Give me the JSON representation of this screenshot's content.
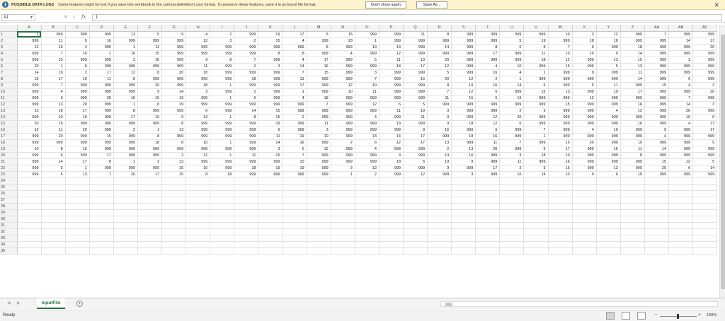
{
  "message_bar": {
    "title": "POSSIBLE DATA LOSS",
    "text": "Some features might be lost if you save this workbook in the comma-delimited (.csv) format. To preserve these features, save it in an Excel file format.",
    "dont_show_label": "Don't show again",
    "save_as_label": "Save As..."
  },
  "formula_bar": {
    "name_box": "A1",
    "formula": "1"
  },
  "columns": [
    "A",
    "B",
    "C",
    "D",
    "E",
    "F",
    "G",
    "H",
    "I",
    "J",
    "K",
    "L",
    "M",
    "N",
    "O",
    "P",
    "Q",
    "R",
    "S",
    "T",
    "U",
    "V",
    "W",
    "X",
    "Y",
    "Z",
    "AA",
    "AB",
    "AC"
  ],
  "rows": [
    [
      "1",
      "999",
      "999",
      "999",
      "13",
      "5",
      "9",
      "4",
      "2",
      "999",
      "19",
      "17",
      "6",
      "15",
      "999",
      "999",
      "11",
      "8",
      "999",
      "999",
      "999",
      "999",
      "10",
      "3",
      "12",
      "999",
      "7",
      "999",
      "999"
    ],
    [
      "999",
      "11",
      "9",
      "16",
      "999",
      "999",
      "999",
      "12",
      "3",
      "2",
      "15",
      "4",
      "999",
      "20",
      "1",
      "999",
      "999",
      "999",
      "999",
      "999",
      "5",
      "19",
      "999",
      "18",
      "10",
      "999",
      "999",
      "14",
      "17"
    ],
    [
      "12",
      "15",
      "4",
      "999",
      "1",
      "11",
      "999",
      "999",
      "999",
      "999",
      "999",
      "999",
      "8",
      "999",
      "19",
      "13",
      "999",
      "14",
      "999",
      "8",
      "6",
      "9",
      "7",
      "5",
      "999",
      "18",
      "999",
      "999",
      "20"
    ],
    [
      "999",
      "7",
      "20",
      "1",
      "16",
      "15",
      "999",
      "999",
      "999",
      "999",
      "8",
      "8",
      "999",
      "4",
      "999",
      "12",
      "999",
      "999",
      "999",
      "17",
      "999",
      "11",
      "13",
      "19",
      "9",
      "14",
      "999",
      "999",
      "999"
    ],
    [
      "999",
      "10",
      "999",
      "999",
      "2",
      "16",
      "999",
      "9",
      "8",
      "7",
      "999",
      "4",
      "17",
      "999",
      "5",
      "11",
      "19",
      "20",
      "999",
      "999",
      "999",
      "18",
      "12",
      "999",
      "13",
      "15",
      "999",
      "3",
      "999"
    ],
    [
      "20",
      "1",
      "6",
      "999",
      "999",
      "999",
      "999",
      "11",
      "999",
      "2",
      "3",
      "14",
      "16",
      "999",
      "999",
      "18",
      "17",
      "12",
      "999",
      "4",
      "10",
      "999",
      "15",
      "999",
      "5",
      "13",
      "999",
      "999",
      "999"
    ],
    [
      "14",
      "10",
      "2",
      "17",
      "12",
      "8",
      "20",
      "18",
      "999",
      "999",
      "999",
      "7",
      "15",
      "999",
      "3",
      "999",
      "999",
      "5",
      "999",
      "16",
      "4",
      "1",
      "999",
      "9",
      "999",
      "11",
      "999",
      "999",
      "999"
    ],
    [
      "15",
      "17",
      "10",
      "11",
      "8",
      "999",
      "999",
      "999",
      "999",
      "18",
      "999",
      "13",
      "999",
      "999",
      "7",
      "999",
      "16",
      "20",
      "12",
      "2",
      "1",
      "999",
      "999",
      "999",
      "999",
      "14",
      "999",
      "6",
      "999"
    ],
    [
      "999",
      "7",
      "999",
      "999",
      "999",
      "20",
      "999",
      "18",
      "1",
      "999",
      "999",
      "17",
      "999",
      "12",
      "19",
      "999",
      "999",
      "8",
      "10",
      "16",
      "14",
      "6",
      "999",
      "5",
      "11",
      "999",
      "15",
      "4",
      "3"
    ],
    [
      "999",
      "4",
      "999",
      "999",
      "999",
      "9",
      "14",
      "3",
      "999",
      "2",
      "999",
      "1",
      "999",
      "10",
      "11",
      "999",
      "999",
      "7",
      "12",
      "6",
      "999",
      "15",
      "13",
      "999",
      "19",
      "17",
      "999",
      "999",
      "20"
    ],
    [
      "999",
      "9",
      "999",
      "20",
      "16",
      "10",
      "13",
      "999",
      "1",
      "6",
      "999",
      "4",
      "18",
      "999",
      "999",
      "999",
      "999",
      "11",
      "15",
      "5",
      "19",
      "999",
      "999",
      "12",
      "999",
      "999",
      "999",
      "7",
      "999"
    ],
    [
      "999",
      "13",
      "20",
      "999",
      "1",
      "8",
      "19",
      "999",
      "999",
      "999",
      "999",
      "999",
      "7",
      "999",
      "12",
      "6",
      "5",
      "999",
      "999",
      "999",
      "999",
      "999",
      "15",
      "999",
      "999",
      "16",
      "999",
      "14",
      "3"
    ],
    [
      "13",
      "18",
      "17",
      "999",
      "8",
      "999",
      "999",
      "6",
      "999",
      "14",
      "15",
      "999",
      "999",
      "999",
      "999",
      "11",
      "19",
      "3",
      "999",
      "999",
      "2",
      "9",
      "999",
      "999",
      "4",
      "12",
      "999",
      "20",
      "999"
    ],
    [
      "999",
      "10",
      "10",
      "999",
      "17",
      "19",
      "9",
      "13",
      "1",
      "8",
      "15",
      "2",
      "999",
      "999",
      "4",
      "999",
      "11",
      "3",
      "999",
      "12",
      "20",
      "999",
      "999",
      "999",
      "999",
      "999",
      "999",
      "16",
      "6"
    ],
    [
      "20",
      "15",
      "999",
      "999",
      "999",
      "999",
      "8",
      "999",
      "999",
      "999",
      "19",
      "999",
      "11",
      "999",
      "999",
      "13",
      "999",
      "9",
      "18",
      "12",
      "6",
      "999",
      "999",
      "999",
      "999",
      "16",
      "999",
      "4",
      "17"
    ],
    [
      "12",
      "11",
      "20",
      "999",
      "2",
      "1",
      "13",
      "999",
      "999",
      "999",
      "6",
      "999",
      "3",
      "999",
      "999",
      "999",
      "8",
      "15",
      "999",
      "5",
      "999",
      "7",
      "999",
      "4",
      "19",
      "999",
      "9",
      "999",
      "17"
    ],
    [
      "999",
      "20",
      "999",
      "15",
      "999",
      "8",
      "999",
      "999",
      "999",
      "999",
      "11",
      "19",
      "10",
      "999",
      "13",
      "14",
      "17",
      "999",
      "18",
      "16",
      "999",
      "1",
      "999",
      "999",
      "999",
      "999",
      "4",
      "999",
      "999"
    ],
    [
      "999",
      "999",
      "999",
      "999",
      "999",
      "18",
      "8",
      "10",
      "1",
      "999",
      "14",
      "16",
      "999",
      "2",
      "6",
      "12",
      "17",
      "13",
      "999",
      "11",
      "7",
      "999",
      "15",
      "20",
      "999",
      "19",
      "999",
      "999",
      "5"
    ],
    [
      "10",
      "8",
      "15",
      "999",
      "999",
      "999",
      "999",
      "999",
      "999",
      "999",
      "3",
      "5",
      "12",
      "999",
      "4",
      "999",
      "999",
      "2",
      "13",
      "20",
      "999",
      "6",
      "17",
      "999",
      "16",
      "11",
      "14",
      "999",
      "999"
    ],
    [
      "999",
      "6",
      "999",
      "17",
      "999",
      "999",
      "2",
      "12",
      "1",
      "11",
      "19",
      "7",
      "999",
      "999",
      "999",
      "4",
      "999",
      "14",
      "16",
      "999",
      "3",
      "18",
      "10",
      "999",
      "999",
      "8",
      "999",
      "999",
      "999"
    ],
    [
      "999",
      "14",
      "17",
      "8",
      "1",
      "2",
      "13",
      "999",
      "999",
      "999",
      "999",
      "10",
      "999",
      "999",
      "999",
      "18",
      "6",
      "19",
      "9",
      "999",
      "11",
      "999",
      "16",
      "999",
      "999",
      "999",
      "15",
      "12",
      "5"
    ],
    [
      "999",
      "5",
      "1",
      "999",
      "999",
      "999",
      "15",
      "10",
      "999",
      "18",
      "19",
      "19",
      "999",
      "3",
      "12",
      "999",
      "999",
      "9",
      "999",
      "17",
      "2",
      "3",
      "15",
      "999",
      "13",
      "999",
      "20",
      "6",
      "14"
    ],
    [
      "999",
      "5",
      "13",
      "7",
      "20",
      "17",
      "15",
      "8",
      "18",
      "999",
      "999",
      "999",
      "999",
      "1",
      "2",
      "999",
      "12",
      "999",
      "3",
      "999",
      "16",
      "14",
      "10",
      "9",
      "6",
      "19",
      "999",
      "999",
      "999"
    ]
  ],
  "row_numbers": [
    "1",
    "2",
    "3",
    "4",
    "5",
    "6",
    "7",
    "8",
    "9",
    "10",
    "11",
    "12",
    "13",
    "14",
    "15",
    "16",
    "17",
    "18",
    "19",
    "20",
    "21",
    "22",
    "23",
    "24",
    "25",
    "26",
    "27",
    "28",
    "29",
    "30",
    "31",
    "32",
    "33",
    "34",
    "35"
  ],
  "sheet_tab": "inputFile",
  "status": {
    "ready": "Ready",
    "zoom": "100%"
  },
  "colors": {
    "accent": "#217346",
    "message_bg": "#fff4ce"
  }
}
